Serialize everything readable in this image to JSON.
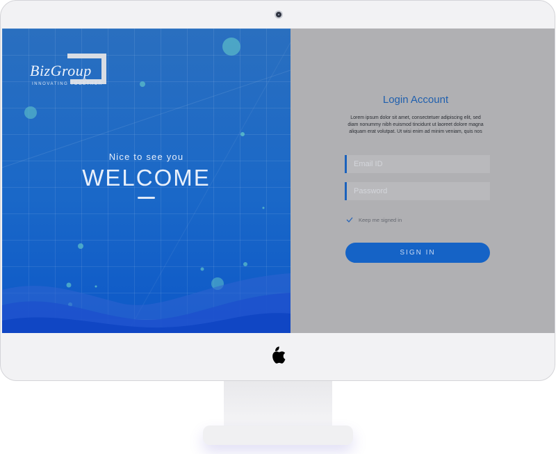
{
  "brand": {
    "name": "BizGroup",
    "tagline": "INNOVATING TOGETHER"
  },
  "hero": {
    "greeting": "Nice to see you",
    "headline": "WELCOME"
  },
  "login": {
    "title": "Login Account",
    "description": "Lorem ipsum dolor sit amet, consectetuer adipiscing elit, sed diam nonummy nibh euismod tincidunt ut laoreet dolore magna aliquam erat volutpat. Ut wisi enim ad minim veniam, quis nos",
    "email_placeholder": "Email ID",
    "password_placeholder": "Password",
    "remember_label": "Keep me signed in",
    "remember_checked": true,
    "submit_label": "SIGN IN"
  },
  "colors": {
    "accent": "#1563c6",
    "hero_gradient_top": "#2a6fbf",
    "hero_gradient_bottom": "#0d58c8",
    "panel_background": "#b0b0b3",
    "title_color": "#1f5fae"
  },
  "icons": {
    "camera": "camera-icon",
    "checkbox": "check-icon",
    "logo": "apple-logo-icon"
  }
}
